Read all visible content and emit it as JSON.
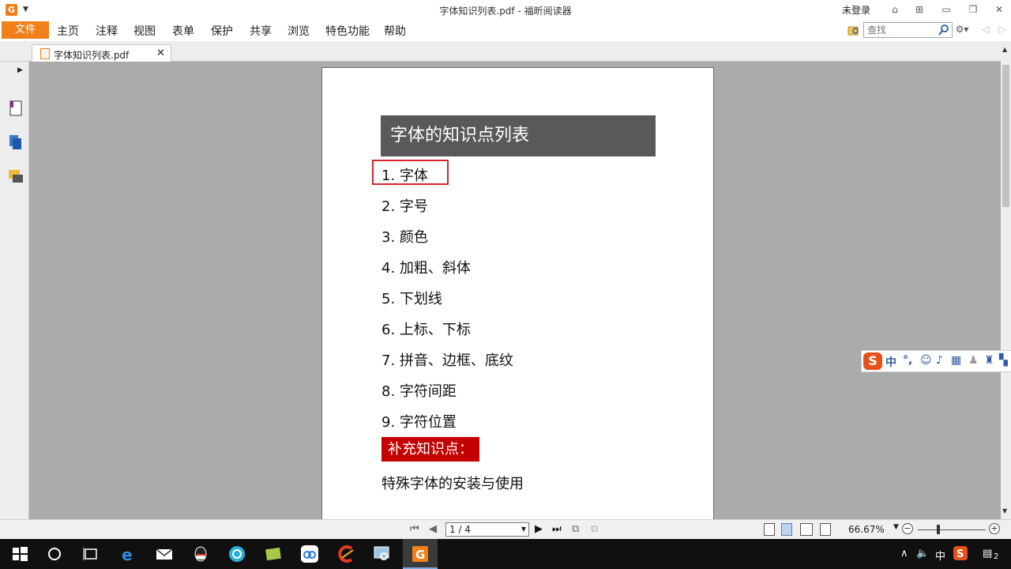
{
  "window": {
    "title": "字体知识列表.pdf - 福昕阅读器",
    "login": "未登录"
  },
  "menu": {
    "file": "文件",
    "items": [
      "主页",
      "注释",
      "视图",
      "表单",
      "保护",
      "共享",
      "浏览",
      "特色功能",
      "帮助"
    ],
    "search_placeholder": "查找"
  },
  "tab": {
    "label": "字体知识列表.pdf"
  },
  "document": {
    "heading": "字体的知识点列表",
    "items": [
      "1. 字体",
      "2. 字号",
      "3. 颜色",
      "4. 加粗、斜体",
      "5. 下划线",
      "6. 上标、下标",
      "7. 拼音、边框、底纹",
      "8. 字符间距",
      "9. 字符位置"
    ],
    "supplement_label": "补充知识点：",
    "supplement_text": "特殊字体的安装与使用"
  },
  "ime": {
    "mode": "中",
    "punct": "°,"
  },
  "status": {
    "page": "1 / 4",
    "zoom": "66.67%"
  },
  "tray": {
    "lang": "中",
    "notify_count": "2"
  }
}
